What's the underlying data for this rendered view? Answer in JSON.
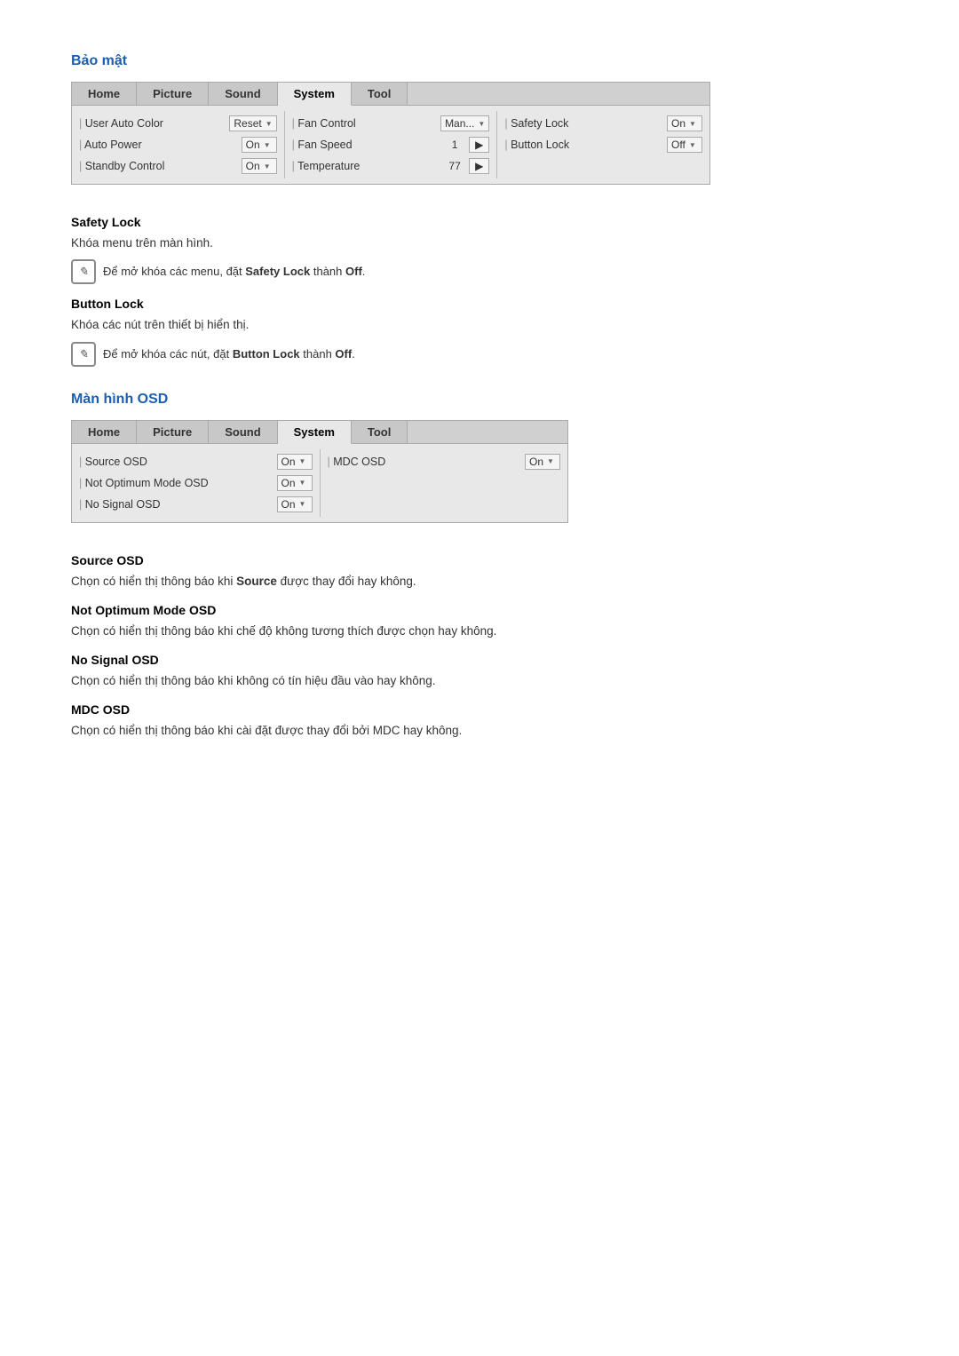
{
  "sections": {
    "bao_mat": {
      "title": "Bảo mật",
      "menu": {
        "tabs": [
          "Home",
          "Picture",
          "Sound",
          "System",
          "Tool"
        ],
        "active_tab": "System",
        "columns": [
          {
            "rows": [
              {
                "label": "User Auto Color",
                "value": "Reset",
                "type": "dropdown"
              },
              {
                "label": "Auto Power",
                "value": "On",
                "type": "dropdown"
              },
              {
                "label": "Standby Control",
                "value": "On",
                "type": "dropdown"
              }
            ]
          },
          {
            "rows": [
              {
                "label": "Fan Control",
                "value": "Man...",
                "type": "dropdown"
              },
              {
                "label": "Fan Speed",
                "value": "1",
                "type": "nav"
              },
              {
                "label": "Temperature",
                "value": "77",
                "type": "nav"
              }
            ]
          },
          {
            "rows": [
              {
                "label": "Safety Lock",
                "value": "On",
                "type": "dropdown"
              },
              {
                "label": "Button Lock",
                "value": "Off",
                "type": "dropdown"
              }
            ]
          }
        ]
      },
      "subsections": [
        {
          "id": "safety_lock",
          "title": "Safety Lock",
          "description": "Khóa menu trên màn hình.",
          "note": "Để mở khóa các menu, đặt Safety Lock thành Off.",
          "note_bold_parts": [
            "Safety Lock",
            "Off"
          ]
        },
        {
          "id": "button_lock",
          "title": "Button Lock",
          "description": "Khóa các nút trên thiết bị hiển thị.",
          "note": "Để mở khóa các nút, đặt Button Lock thành Off.",
          "note_bold_parts": [
            "Button Lock",
            "Off"
          ]
        }
      ]
    },
    "man_hinh_osd": {
      "title": "Màn hình OSD",
      "menu": {
        "tabs": [
          "Home",
          "Picture",
          "Sound",
          "System",
          "Tool"
        ],
        "active_tab": "System",
        "columns": [
          {
            "rows": [
              {
                "label": "Source OSD",
                "value": "On",
                "type": "dropdown"
              },
              {
                "label": "Not Optimum Mode OSD",
                "value": "On",
                "type": "dropdown"
              },
              {
                "label": "No Signal OSD",
                "value": "On",
                "type": "dropdown"
              }
            ]
          },
          {
            "rows": [
              {
                "label": "MDC OSD",
                "value": "On",
                "type": "dropdown"
              }
            ]
          }
        ]
      },
      "subsections": [
        {
          "id": "source_osd",
          "title": "Source OSD",
          "description": "Chọn có hiển thị thông báo khi Source được thay đổi hay không.",
          "bold_in_desc": [
            "Source"
          ]
        },
        {
          "id": "not_optimum",
          "title": "Not Optimum Mode OSD",
          "description": "Chọn có hiển thị thông báo khi chế độ không tương thích được chọn hay không."
        },
        {
          "id": "no_signal",
          "title": "No Signal OSD",
          "description": "Chọn có hiển thị thông báo khi không có tín hiệu đầu vào hay không."
        },
        {
          "id": "mdc_osd",
          "title": "MDC OSD",
          "description": "Chọn có hiển thị thông báo khi cài đặt được thay đổi bởi MDC hay không."
        }
      ]
    }
  }
}
